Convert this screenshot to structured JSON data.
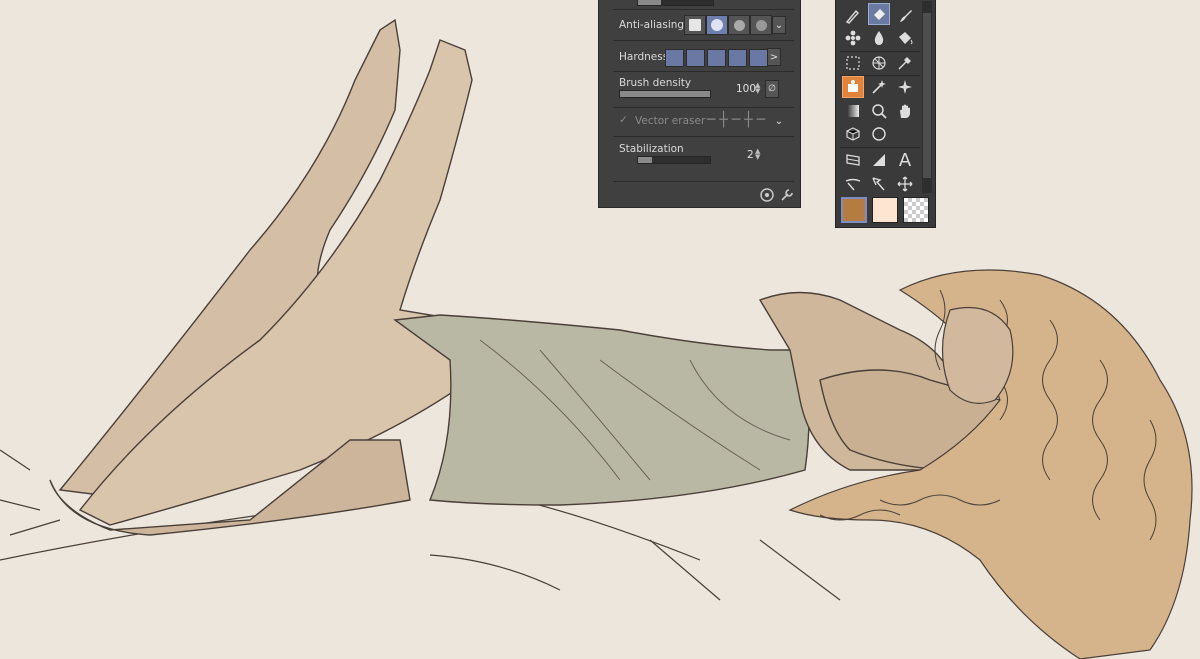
{
  "tool_property": {
    "anti_aliasing_label": "Anti-aliasing",
    "anti_aliasing_selected": 1,
    "hardness_label": "Hardness",
    "hardness_more": ">",
    "brush_density_label": "Brush density",
    "brush_density_value": "100",
    "brush_density_level": 1.0,
    "vector_eraser_label": "Vector eraser",
    "vector_eraser_check": "✓",
    "stabilization_label": "Stabilization",
    "stabilization_value": "2",
    "stabilization_level": 0.2
  },
  "tool_palette": {
    "active_tool": "eraser-tool",
    "selected_tool": "eraser-variant-tool",
    "main_color": "#b57b40",
    "sub_color": "#fde5d1",
    "text_tool_glyph": "A"
  },
  "colors": {
    "canvas_bg": "#ece6dd",
    "skin": "#d4bea6",
    "dress": "#b9b8a5",
    "hair": "#d6b48b",
    "line": "#4a3f38"
  }
}
